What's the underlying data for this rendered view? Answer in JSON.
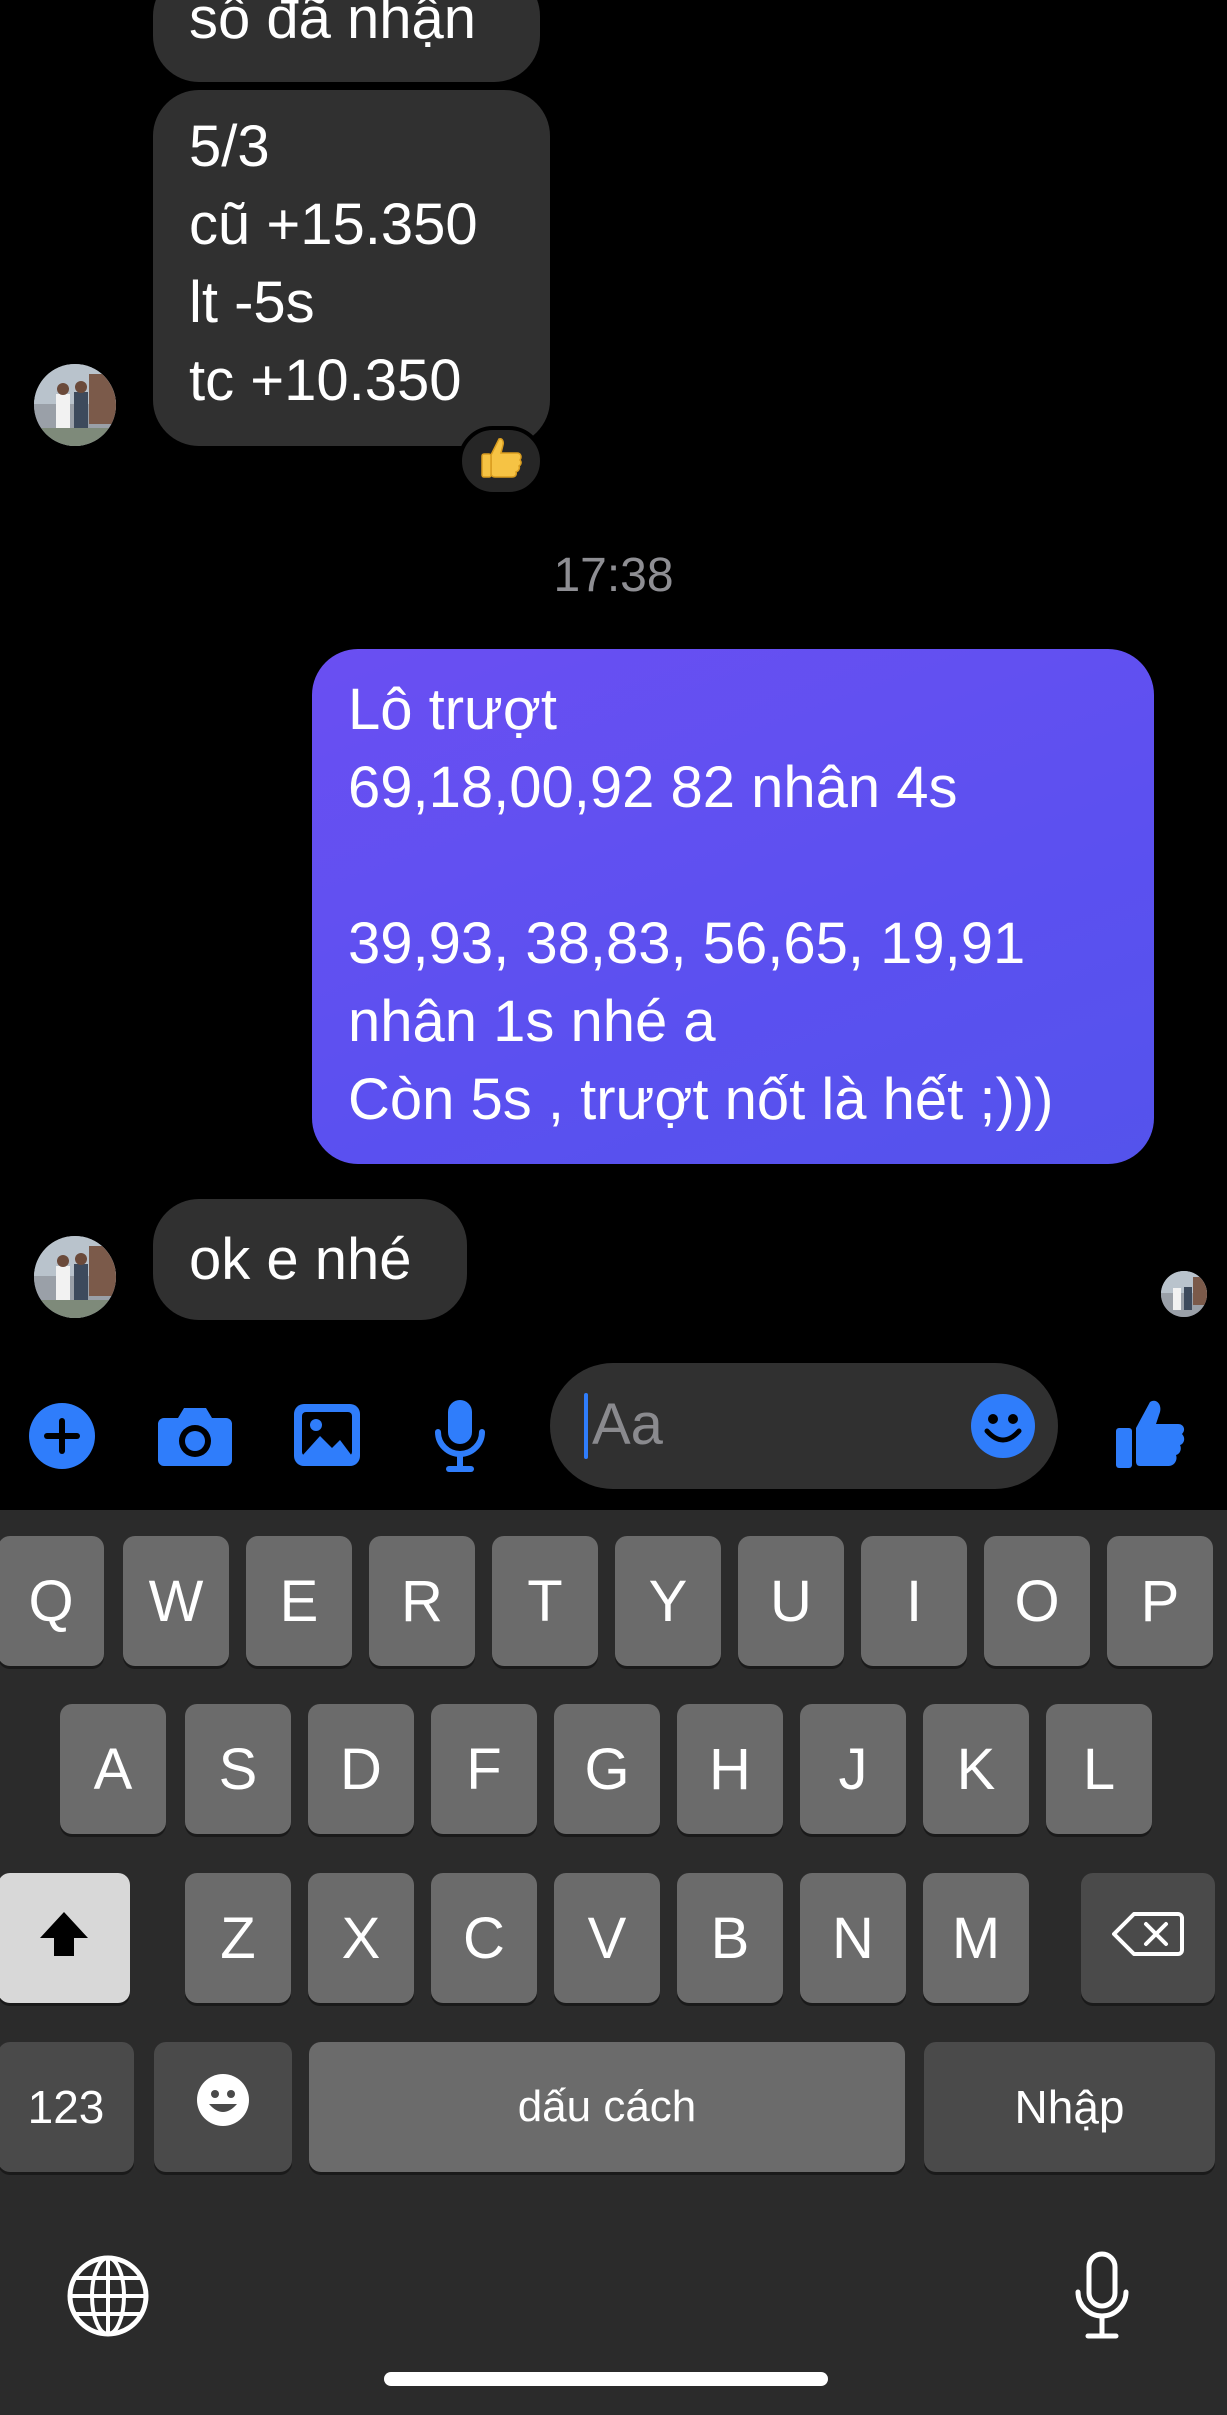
{
  "conversation": {
    "top_partial_message": "số đã nhận",
    "incoming_message_1": "5/3\ncũ +15.350\nlt -5s\ntc +10.350",
    "reaction_icon": "thumbs-up-emoji",
    "timestamp": "17:38",
    "outgoing_message": "Lô trượt\n69,18,00,92 82 nhân 4s\n\n39,93, 38,83, 56,65, 19,91\nnhân 1s nhé a\nCòn 5s , trượt nốt là hết ;)))",
    "incoming_message_2": "ok e nhé"
  },
  "composer": {
    "placeholder": "Aa",
    "icons": [
      "plus-icon",
      "camera-icon",
      "image-icon",
      "microphone-icon",
      "emoji-icon",
      "thumbs-up-icon"
    ],
    "accent_color": "#2f7dfb"
  },
  "keyboard": {
    "row1": [
      "Q",
      "W",
      "E",
      "R",
      "T",
      "Y",
      "U",
      "I",
      "O",
      "P"
    ],
    "row2": [
      "A",
      "S",
      "D",
      "F",
      "G",
      "H",
      "J",
      "K",
      "L"
    ],
    "row3": [
      "Z",
      "X",
      "C",
      "V",
      "B",
      "N",
      "M"
    ],
    "numbers_key": "123",
    "space_key": "dấu cách",
    "return_key": "Nhập"
  },
  "colors": {
    "background": "#000000",
    "incoming_bubble": "#303030",
    "outgoing_bubble": "#5b50f0",
    "keyboard_bg": "#2b2b2b"
  }
}
